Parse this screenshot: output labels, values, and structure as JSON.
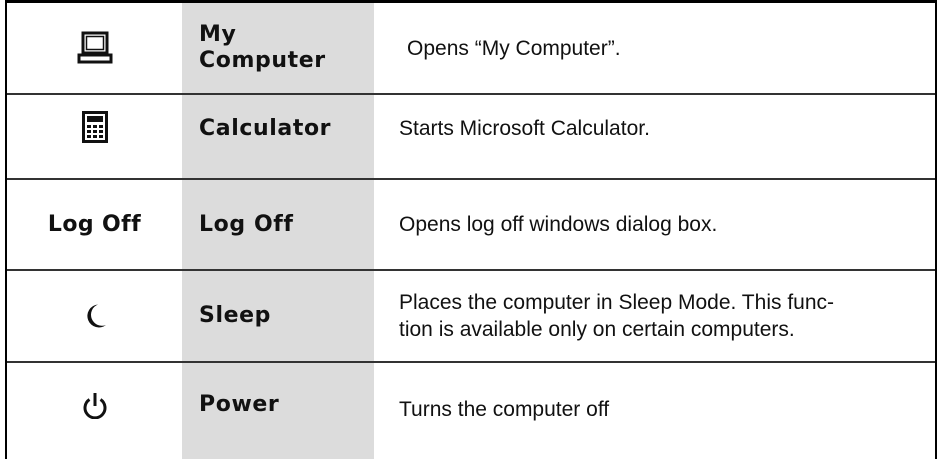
{
  "rows": [
    {
      "icon": "laptop-icon",
      "name": "My Computer",
      "name_lines": [
        "My",
        "Computer"
      ],
      "description": "Opens “My Computer”."
    },
    {
      "icon": "calculator-icon",
      "name": "Calculator",
      "description": "Starts Microsoft Calculator."
    },
    {
      "icon_text": "Log Off",
      "name": "Log Off",
      "description": "Opens log off windows dialog box."
    },
    {
      "icon": "moon-icon",
      "name": "Sleep",
      "description_lines": [
        "Places the computer in Sleep Mode. This func-",
        "tion is available only on certain computers."
      ]
    },
    {
      "icon": "power-icon",
      "name": "Power",
      "description": "Turns the computer off"
    }
  ]
}
